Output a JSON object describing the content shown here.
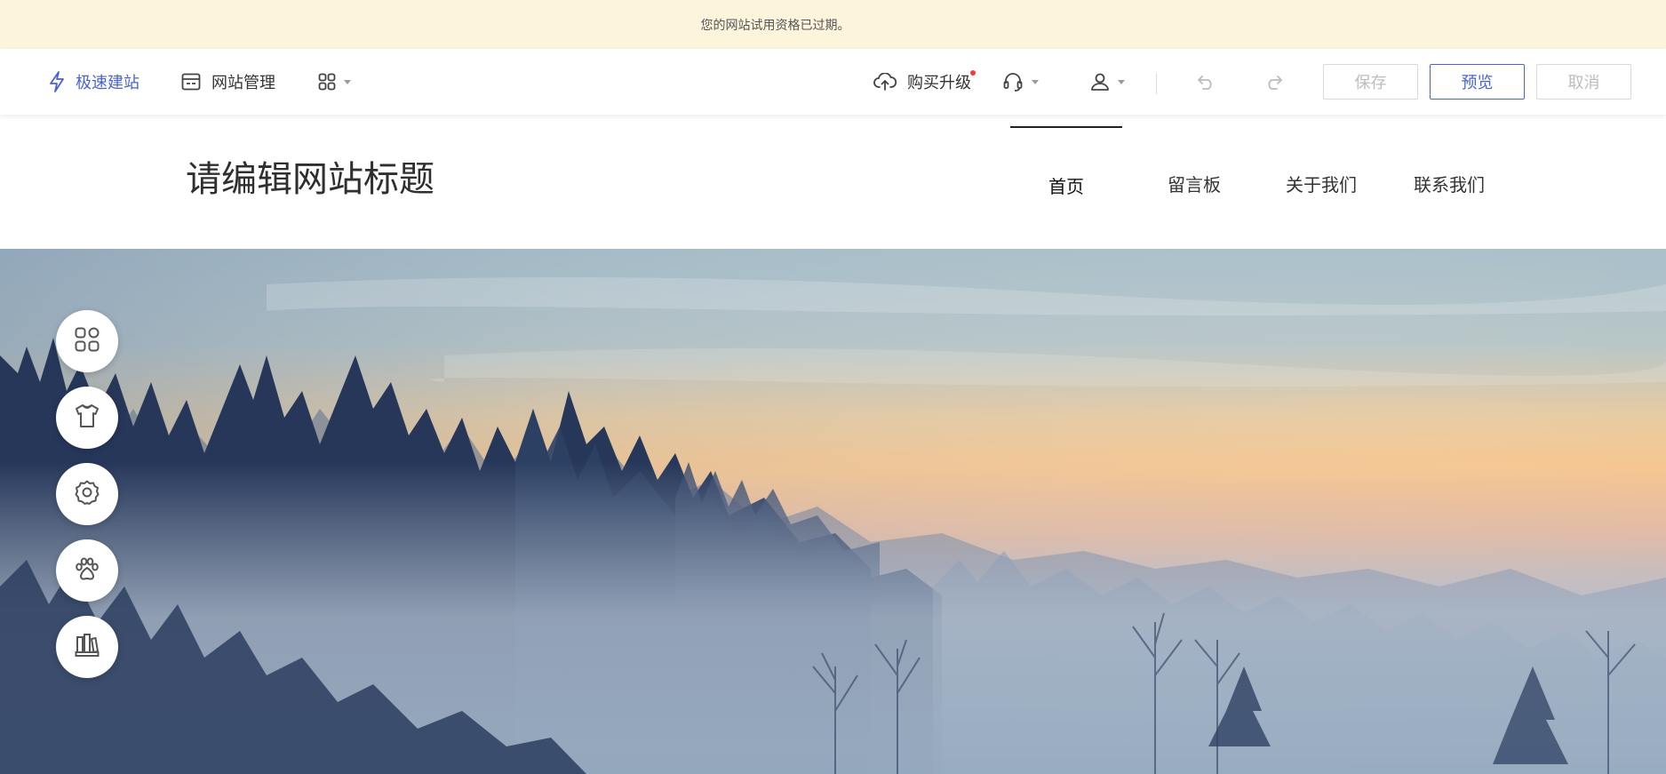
{
  "banner": {
    "message": "您的网站试用资格已过期。"
  },
  "toolbar": {
    "quick_build_label": "极速建站",
    "site_manage_label": "网站管理",
    "apps_icon": "grid-icon",
    "upgrade_label": "购买升级",
    "support_icon": "headset-icon",
    "account_icon": "user-icon",
    "undo_icon": "undo-icon",
    "redo_icon": "redo-icon",
    "save_label": "保存",
    "preview_label": "预览",
    "cancel_label": "取消"
  },
  "site": {
    "title": "请编辑网站标题",
    "nav": [
      {
        "label": "首页",
        "current": true
      },
      {
        "label": "留言板",
        "current": false
      },
      {
        "label": "关于我们",
        "current": false
      },
      {
        "label": "联系我们",
        "current": false
      }
    ]
  },
  "side_tools": [
    {
      "icon": "modules-icon"
    },
    {
      "icon": "theme-shirt-icon"
    },
    {
      "icon": "settings-gear-icon"
    },
    {
      "icon": "paw-icon"
    },
    {
      "icon": "library-books-icon"
    }
  ],
  "colors": {
    "accent": "#4a64cf",
    "banner_bg": "#fdf4dc",
    "badge": "#f23b3b"
  }
}
